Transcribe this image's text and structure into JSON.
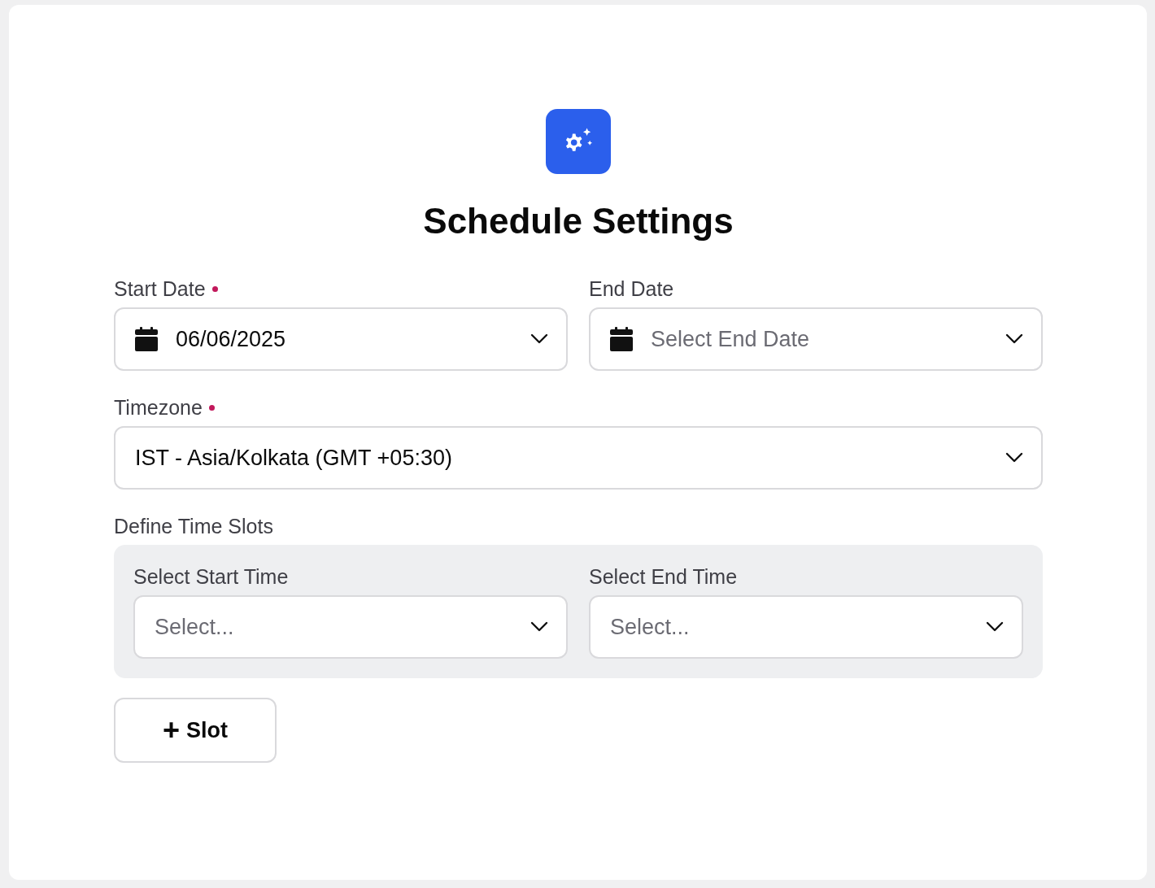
{
  "title": "Schedule Settings",
  "date_fields": [
    {
      "label": "Start Date",
      "required": true,
      "value": "06/06/2025"
    },
    {
      "label": "End Date",
      "required": false,
      "placeholder": "Select End Date"
    }
  ],
  "timezone": {
    "label": "Timezone",
    "required": true,
    "value": "IST - Asia/Kolkata (GMT +05:30)"
  },
  "time_slots": {
    "label": "Define Time Slots",
    "fields": [
      {
        "label": "Select Start Time",
        "placeholder": "Select..."
      },
      {
        "label": "Select End Time",
        "placeholder": "Select..."
      }
    ]
  },
  "add_slot_button": {
    "icon": "+",
    "label": "Slot"
  }
}
